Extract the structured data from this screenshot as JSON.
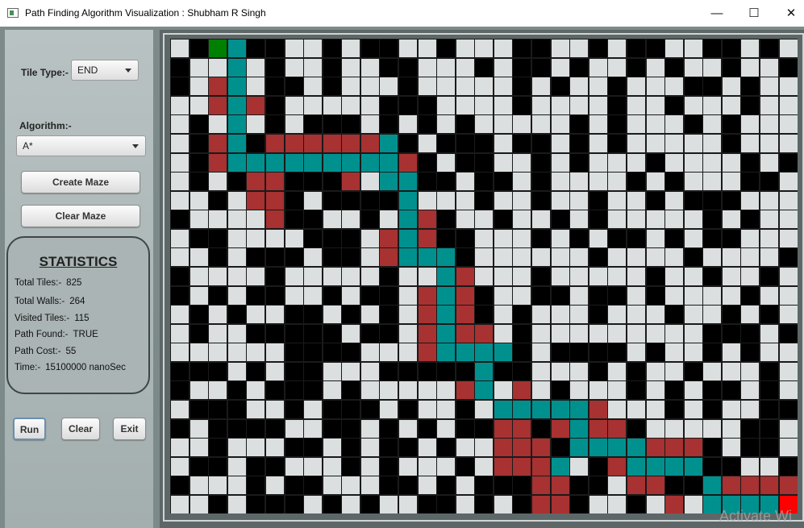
{
  "window": {
    "title": "Path Finding Algorithm Visualization : Shubham R Singh",
    "minimize": "—",
    "maximize": "☐",
    "close": "✕"
  },
  "sidebar": {
    "tile_type_label": "Tile Type:-",
    "tile_type_value": "END",
    "algorithm_label": "Algorithm:-",
    "algorithm_value": "A*",
    "create_maze": "Create Maze",
    "clear_maze": "Clear Maze",
    "run": "Run",
    "clear": "Clear",
    "exit": "Exit"
  },
  "stats": {
    "title": "STATISTICS",
    "rows": [
      {
        "label": "Total Tiles:-",
        "value": "825"
      },
      {
        "label": "Total Walls:-",
        "value": "264"
      },
      {
        "label": "Visited Tiles:-",
        "value": "115"
      },
      {
        "label": "Path Found:-",
        "value": "TRUE"
      },
      {
        "label": "Path Cost:-",
        "value": "55"
      },
      {
        "label": "Time:-",
        "value": "15100000 nanoSec"
      }
    ]
  },
  "grid": {
    "cols": 33,
    "rows": 25,
    "legend": {
      ".": "clear",
      "#": "wall",
      "v": "visited",
      "p": "path",
      "s": "start",
      "e": "end"
    },
    "colors": {
      "clear": "#dcdfdf",
      "wall": "#000000",
      "visited": "#a83131",
      "path": "#00918f",
      "start": "#008000",
      "end": "#ff0000",
      "grid_line": "#1a1a1a"
    },
    "cells": [
      ".#sp##..#.##..#...##..#.##..##.#.",
      "#..p.#..#..##...#.##.#..#.#..#..#",
      "#.vp.##.#...#.....#.#..#...##.#..",
      "..vpv#.....###....#....#..#...#..",
      ".#.p.#.###.#.#.#.....#.#...#.#...",
      ".#vp#vvvvvvp#.###.##.#.#.....#...",
      ".#vpppppppppv#.##..#.#...#....#.#",
      ".#.#vv###v.pp##.##.#....#.#...##.",
      "..#.vv#.####p...#..#..#..#.###...",
      "#....v##..#.pv#..#..#.#.....#.#..",
      ".##....###.vpv##...#.#.##.#.##...",
      "..#.###.##.vppp#......#....#....#",
      "#....#.....#..pv...#.....#..#..#.",
      "#.#.##..#.##.vpv#..##.##.#....#..",
      ".#.#..##.#.#.vpv#.#...#...#..#.#.",
      ".#..#####.##.vpvv.#.........###.#",
      "......####...vpppp#.####.#..#.#..",
      "###.#.##...#####p##...#.#..#...#.",
      "#..#.###.#.....vp.v.#...#.#.##.#.",
      ".###..#.###.#..#.pppppv...#.#..##",
      "#.####..##.#.#.##vv#vpvv#.....##.",
      "..#...##.#.##.#..vvv#ppppvvv#.##.",
      ".##.##...#.#...#.vvvp.#vpppp##..#",
      "#...#.##...##.#.###vv##.vv##pvvvv",
      "..#.###.#.#..##.#.#vv#..#.v.ppppe"
    ]
  }
}
